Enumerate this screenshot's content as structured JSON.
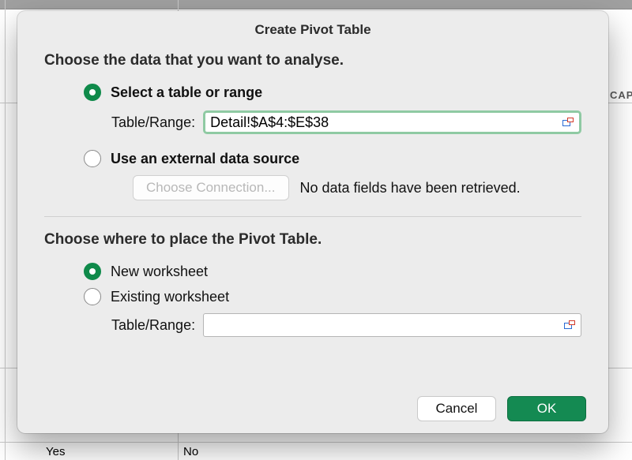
{
  "dialog": {
    "title": "Create Pivot Table",
    "section1_heading": "Choose the data that you want to analyse.",
    "select_range_label": "Select a table or range",
    "range_label": "Table/Range:",
    "range_value": "Detail!$A$4:$E$38",
    "external_source_label": "Use an external data source",
    "choose_connection_label": "Choose Connection...",
    "no_fields_text": "No data fields have been retrieved.",
    "section2_heading": "Choose where to place the Pivot Table.",
    "new_worksheet_label": "New worksheet",
    "existing_worksheet_label": "Existing worksheet",
    "place_range_label": "Table/Range:",
    "place_range_value": "",
    "cancel_label": "Cancel",
    "ok_label": "OK"
  },
  "bg": {
    "cap_text": "CAP",
    "cell_yes": "Yes",
    "cell_no": "No"
  }
}
